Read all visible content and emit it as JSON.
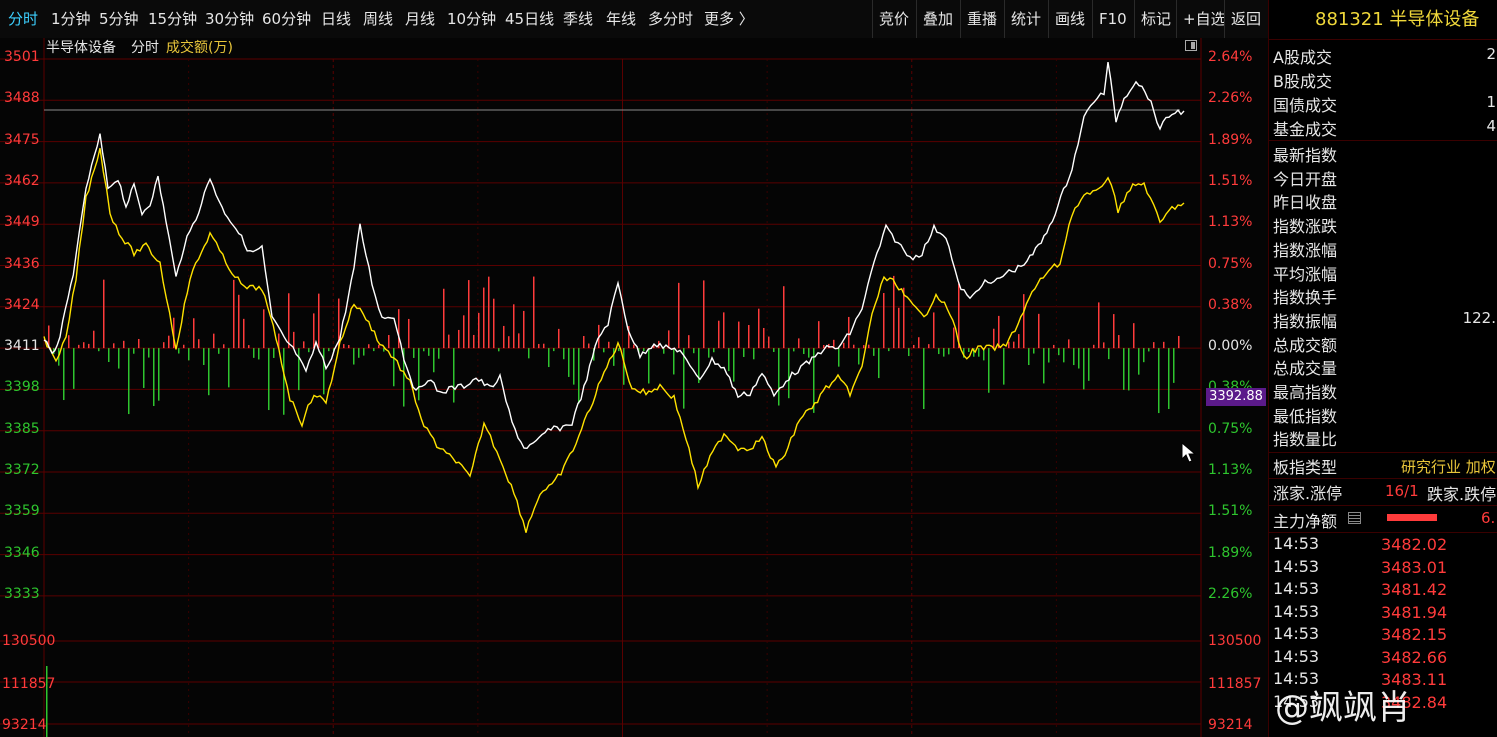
{
  "toolbar": {
    "tabs": [
      "分时",
      "1分钟",
      "5分钟",
      "15分钟",
      "30分钟",
      "60分钟",
      "日线",
      "周线",
      "月线",
      "10分钟",
      "45日线",
      "季线",
      "年线",
      "多分时",
      "更多 〉"
    ],
    "actions": [
      "竞价",
      "叠加",
      "重播",
      "统计",
      "画线",
      "F10",
      "标记",
      "+自选",
      "返回"
    ]
  },
  "chart": {
    "name": "半导体设备",
    "mode": "分时",
    "sub": "成交额(万)",
    "left_axis_red": [
      "3501",
      "3488",
      "3475",
      "3462",
      "3449",
      "3436",
      "3424"
    ],
    "left_axis_mid": "3411",
    "left_axis_green": [
      "3398",
      "3385",
      "3372",
      "3359",
      "3346",
      "3333"
    ],
    "right_axis_red": [
      "2.64%",
      "2.26%",
      "1.89%",
      "1.51%",
      "1.13%",
      "0.75%",
      "0.38%"
    ],
    "right_axis_mid": "0.00%",
    "right_axis_green": [
      "0.38%",
      "0.75%",
      "1.13%",
      "1.51%",
      "1.89%",
      "2.26%"
    ],
    "vol_left": [
      "130500",
      "111857",
      "93214"
    ],
    "vol_right": [
      "130500",
      "111857",
      "93214"
    ],
    "price_tag": "3392.88",
    "colors": {
      "up": "#ff3b3b",
      "down": "#2ec52e",
      "price": "#ffffff",
      "avg": "#ffe200",
      "grid": "#5a0000"
    }
  },
  "panel": {
    "title": "881321 半导体设备",
    "rows_top": [
      {
        "label": "A股成交",
        "value": "2"
      },
      {
        "label": "B股成交",
        "value": ""
      },
      {
        "label": "国债成交",
        "value": "1"
      },
      {
        "label": "基金成交",
        "value": "4"
      }
    ],
    "rows_mid": [
      {
        "label": "最新指数",
        "value": ""
      },
      {
        "label": "今日开盘",
        "value": ""
      },
      {
        "label": "昨日收盘",
        "value": ""
      },
      {
        "label": "指数涨跌",
        "value": ""
      },
      {
        "label": "指数涨幅",
        "value": ""
      },
      {
        "label": "平均涨幅",
        "value": ""
      },
      {
        "label": "指数换手",
        "value": ""
      },
      {
        "label": "指数振幅",
        "value": "122."
      },
      {
        "label": "总成交额",
        "value": ""
      },
      {
        "label": "总成交量",
        "value": ""
      },
      {
        "label": "最高指数",
        "value": ""
      },
      {
        "label": "最低指数",
        "value": ""
      },
      {
        "label": "指数量比",
        "value": ""
      }
    ],
    "board_type_label": "板指类型",
    "board_type_value": "研究行业 加权",
    "updown_label": "涨家.涨停",
    "updown_value": "16/1",
    "updown_label2": "跌家.跌停",
    "main_net_label": "主力净额",
    "main_net_value": "6.",
    "ticks": [
      {
        "time": "14:53",
        "price": "3482.02"
      },
      {
        "time": "14:53",
        "price": "3483.01"
      },
      {
        "time": "14:53",
        "price": "3481.42"
      },
      {
        "time": "14:53",
        "price": "3481.94"
      },
      {
        "time": "14:53",
        "price": "3482.15"
      },
      {
        "time": "14:53",
        "price": "3482.66"
      },
      {
        "time": "14:53",
        "price": "3483.11"
      },
      {
        "time": "14:53",
        "price": "3482.84"
      }
    ]
  },
  "watermark": "@飒飒肖"
}
